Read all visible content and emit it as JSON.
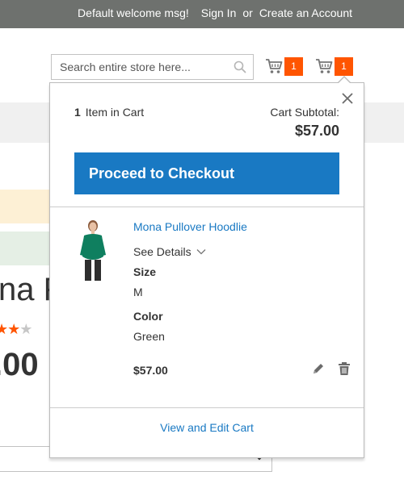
{
  "header": {
    "welcome": "Default welcome msg!",
    "sign_in": "Sign In",
    "or": "or",
    "create_account": "Create an Account"
  },
  "search": {
    "placeholder": "Search entire store here...",
    "icon": "search-icon"
  },
  "minicart": {
    "counter_1": "1",
    "counter_2": "1",
    "badge_color": "#ff5501"
  },
  "background_page": {
    "product_title_fragment": "na F",
    "price_fragment": ".00",
    "rating_stars": {
      "filled": 2,
      "empty": 1
    }
  },
  "dropdown": {
    "item_count": "1",
    "items_label": "Item in Cart",
    "subtotal_label": "Cart Subtotal:",
    "subtotal_value": "$57.00",
    "checkout_label": "Proceed to Checkout",
    "checkout_color": "#1979c3",
    "item": {
      "name": "Mona Pullover Hoodlie",
      "see_details": "See Details",
      "options": [
        {
          "label": "Size",
          "value": "M"
        },
        {
          "label": "Color",
          "value": "Green"
        }
      ],
      "price": "$57.00"
    },
    "view_edit_cart": "View and Edit Cart"
  }
}
